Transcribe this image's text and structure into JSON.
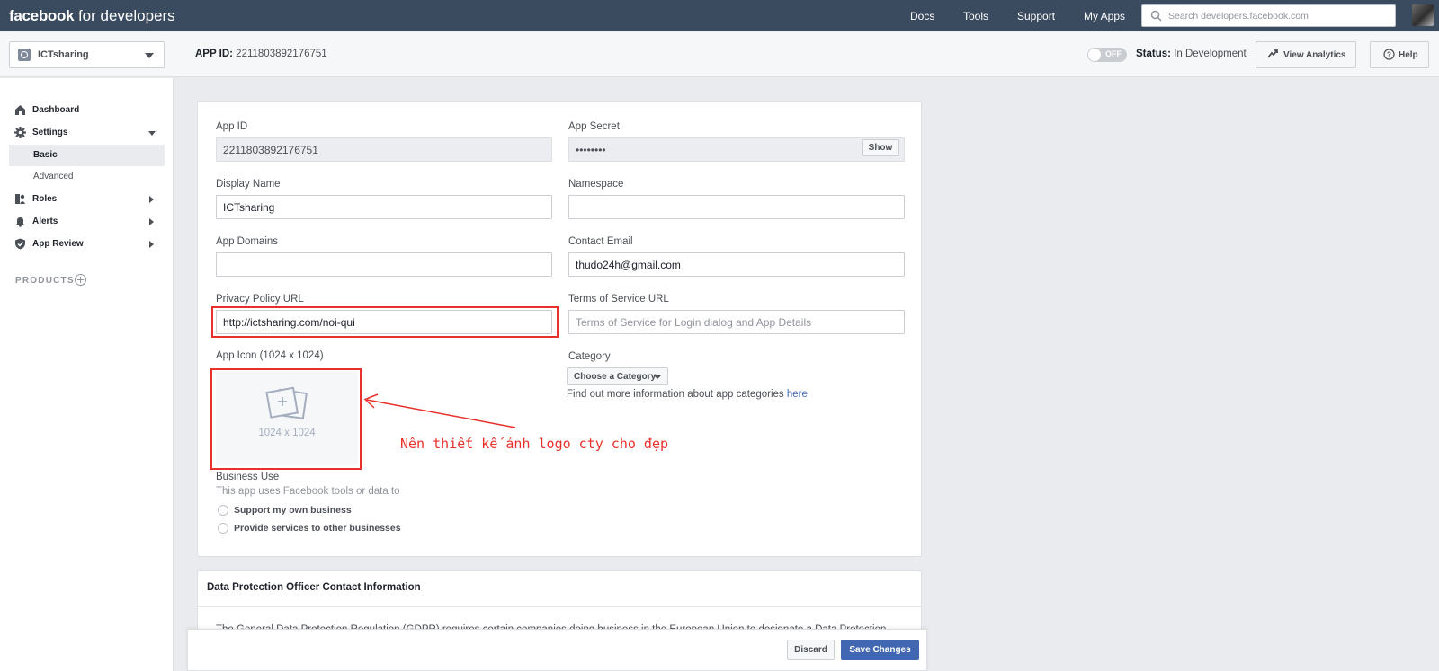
{
  "brand": {
    "bold": "facebook",
    "rest": " for developers"
  },
  "topnav": [
    "Docs",
    "Tools",
    "Support",
    "My Apps"
  ],
  "search": {
    "placeholder": "Search developers.facebook.com",
    "icon": "search-icon"
  },
  "app_header": {
    "app_name": "ICTsharing",
    "app_id_label": "APP ID:",
    "app_id_value": "2211803892176751",
    "toggle_label": "OFF",
    "status_label": "Status:",
    "status_value": "In Development",
    "view_analytics": "View Analytics",
    "help": "Help"
  },
  "sidebar": {
    "dashboard": "Dashboard",
    "settings": "Settings",
    "basic": "Basic",
    "advanced": "Advanced",
    "roles": "Roles",
    "alerts": "Alerts",
    "app_review": "App Review",
    "products": "PRODUCTS"
  },
  "form": {
    "app_id": {
      "label": "App ID",
      "value": "2211803892176751"
    },
    "app_secret": {
      "label": "App Secret",
      "value": "••••••••",
      "show": "Show"
    },
    "display_name": {
      "label": "Display Name",
      "value": "ICTsharing"
    },
    "namespace": {
      "label": "Namespace",
      "value": ""
    },
    "app_domains": {
      "label": "App Domains",
      "value": ""
    },
    "contact_email": {
      "label": "Contact Email",
      "value": "thudo24h@gmail.com"
    },
    "privacy_url": {
      "label": "Privacy Policy URL",
      "value": "http://ictsharing.com/noi-qui"
    },
    "tos_url": {
      "label": "Terms of Service URL",
      "placeholder": "Terms of Service for Login dialog and App Details"
    },
    "app_icon": {
      "label": "App Icon (1024 x 1024)",
      "dims": "1024 x 1024"
    },
    "category": {
      "label": "Category",
      "button": "Choose a Category",
      "info": "Find out more information about app categories ",
      "link": "here"
    },
    "business_use": {
      "label": "Business Use",
      "desc": "This app uses Facebook tools or data to",
      "options": [
        "Support my own business",
        "Provide services to other businesses"
      ]
    }
  },
  "annotation": {
    "note": "Nên thiết kế ảnh logo cty cho đẹp",
    "color": "#e8312b"
  },
  "dpo": {
    "title": "Data Protection Officer Contact Information",
    "body": "The General Data Protection Regulation (GDPR) requires certain companies doing business in the European Union to designate a Data Protection"
  },
  "footer": {
    "discard": "Discard",
    "save": "Save Changes"
  },
  "colors": {
    "topbar": "#3b4b5f",
    "primary": "#4267b2",
    "background": "#e9ebee"
  }
}
